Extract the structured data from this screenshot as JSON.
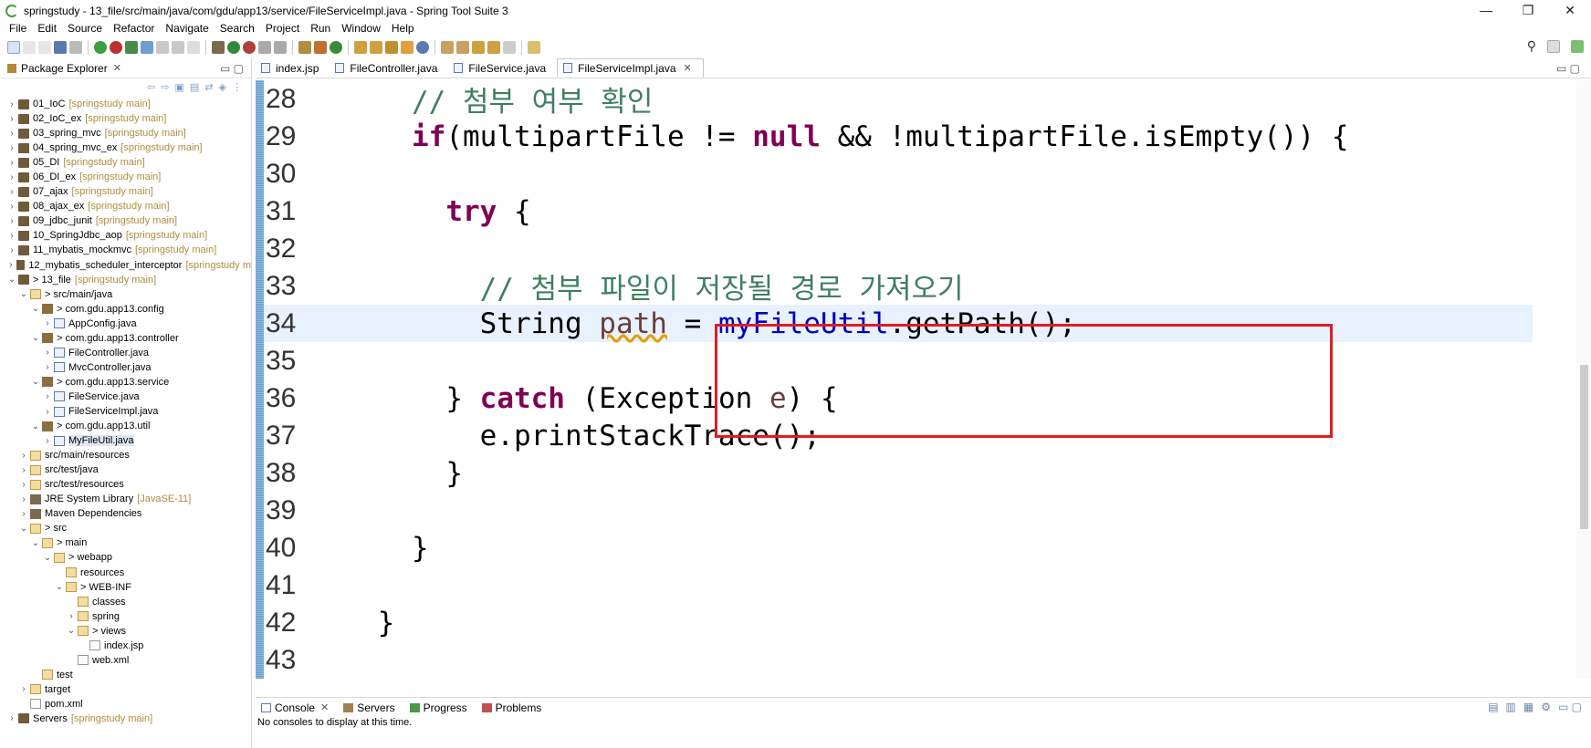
{
  "window": {
    "title": "springstudy - 13_file/src/main/java/com/gdu/app13/service/FileServiceImpl.java - Spring Tool Suite 3",
    "minimize": "—",
    "restore": "❐",
    "close": "✕"
  },
  "menu": [
    "File",
    "Edit",
    "Source",
    "Refactor",
    "Navigate",
    "Search",
    "Project",
    "Run",
    "Window",
    "Help"
  ],
  "package_explorer": {
    "title": "Package Explorer",
    "items": [
      {
        "indent": 0,
        "arrow": ">",
        "icon": "project",
        "label": "01_IoC",
        "dec": "[springstudy main]"
      },
      {
        "indent": 0,
        "arrow": ">",
        "icon": "project",
        "label": "02_IoC_ex",
        "dec": "[springstudy main]"
      },
      {
        "indent": 0,
        "arrow": ">",
        "icon": "project",
        "label": "03_spring_mvc",
        "dec": "[springstudy main]"
      },
      {
        "indent": 0,
        "arrow": ">",
        "icon": "project",
        "label": "04_spring_mvc_ex",
        "dec": "[springstudy main]"
      },
      {
        "indent": 0,
        "arrow": ">",
        "icon": "project",
        "label": "05_DI",
        "dec": "[springstudy main]"
      },
      {
        "indent": 0,
        "arrow": ">",
        "icon": "project",
        "label": "06_DI_ex",
        "dec": "[springstudy main]"
      },
      {
        "indent": 0,
        "arrow": ">",
        "icon": "project",
        "label": "07_ajax",
        "dec": "[springstudy main]"
      },
      {
        "indent": 0,
        "arrow": ">",
        "icon": "project",
        "label": "08_ajax_ex",
        "dec": "[springstudy main]"
      },
      {
        "indent": 0,
        "arrow": ">",
        "icon": "project",
        "label": "09_jdbc_junit",
        "dec": "[springstudy main]"
      },
      {
        "indent": 0,
        "arrow": ">",
        "icon": "project",
        "label": "10_SpringJdbc_aop",
        "dec": "[springstudy main]"
      },
      {
        "indent": 0,
        "arrow": ">",
        "icon": "project",
        "label": "11_mybatis_mockmvc",
        "dec": "[springstudy main]"
      },
      {
        "indent": 0,
        "arrow": ">",
        "icon": "project",
        "label": "12_mybatis_scheduler_interceptor",
        "dec": "[springstudy m"
      },
      {
        "indent": 0,
        "arrow": "v",
        "icon": "project",
        "label": "> 13_file",
        "dec": "[springstudy main]"
      },
      {
        "indent": 1,
        "arrow": "v",
        "icon": "folder",
        "label": "> src/main/java",
        "dec": ""
      },
      {
        "indent": 2,
        "arrow": "v",
        "icon": "pkg",
        "label": "> com.gdu.app13.config",
        "dec": ""
      },
      {
        "indent": 3,
        "arrow": ">",
        "icon": "java",
        "label": "AppConfig.java",
        "dec": ""
      },
      {
        "indent": 2,
        "arrow": "v",
        "icon": "pkg",
        "label": "> com.gdu.app13.controller",
        "dec": ""
      },
      {
        "indent": 3,
        "arrow": ">",
        "icon": "java",
        "label": "FileController.java",
        "dec": ""
      },
      {
        "indent": 3,
        "arrow": ">",
        "icon": "java",
        "label": "MvcController.java",
        "dec": ""
      },
      {
        "indent": 2,
        "arrow": "v",
        "icon": "pkg",
        "label": "> com.gdu.app13.service",
        "dec": ""
      },
      {
        "indent": 3,
        "arrow": ">",
        "icon": "java",
        "label": "FileService.java",
        "dec": ""
      },
      {
        "indent": 3,
        "arrow": ">",
        "icon": "java",
        "label": "FileServiceImpl.java",
        "dec": ""
      },
      {
        "indent": 2,
        "arrow": "v",
        "icon": "pkg",
        "label": "> com.gdu.app13.util",
        "dec": ""
      },
      {
        "indent": 3,
        "arrow": ">",
        "icon": "java",
        "label": "MyFileUtil.java",
        "dec": "",
        "selected": true
      },
      {
        "indent": 1,
        "arrow": ">",
        "icon": "folder",
        "label": "src/main/resources",
        "dec": ""
      },
      {
        "indent": 1,
        "arrow": ">",
        "icon": "folder",
        "label": "src/test/java",
        "dec": ""
      },
      {
        "indent": 1,
        "arrow": ">",
        "icon": "folder",
        "label": "src/test/resources",
        "dec": ""
      },
      {
        "indent": 1,
        "arrow": ">",
        "icon": "lib",
        "label": "JRE System Library",
        "dec": "[JavaSE-11]"
      },
      {
        "indent": 1,
        "arrow": ">",
        "icon": "lib",
        "label": "Maven Dependencies",
        "dec": ""
      },
      {
        "indent": 1,
        "arrow": "v",
        "icon": "folder",
        "label": "> src",
        "dec": ""
      },
      {
        "indent": 2,
        "arrow": "v",
        "icon": "folder",
        "label": "> main",
        "dec": ""
      },
      {
        "indent": 3,
        "arrow": "v",
        "icon": "folder",
        "label": "> webapp",
        "dec": ""
      },
      {
        "indent": 4,
        "arrow": "",
        "icon": "folder",
        "label": "resources",
        "dec": ""
      },
      {
        "indent": 4,
        "arrow": "v",
        "icon": "folder",
        "label": "> WEB-INF",
        "dec": ""
      },
      {
        "indent": 5,
        "arrow": "",
        "icon": "folder",
        "label": "classes",
        "dec": ""
      },
      {
        "indent": 5,
        "arrow": ">",
        "icon": "folder",
        "label": "spring",
        "dec": ""
      },
      {
        "indent": 5,
        "arrow": "v",
        "icon": "folder",
        "label": "> views",
        "dec": ""
      },
      {
        "indent": 6,
        "arrow": "",
        "icon": "file",
        "label": "index.jsp",
        "dec": ""
      },
      {
        "indent": 5,
        "arrow": "",
        "icon": "file",
        "label": "web.xml",
        "dec": ""
      },
      {
        "indent": 2,
        "arrow": "",
        "icon": "folder",
        "label": "test",
        "dec": ""
      },
      {
        "indent": 1,
        "arrow": ">",
        "icon": "folder",
        "label": "target",
        "dec": ""
      },
      {
        "indent": 1,
        "arrow": "",
        "icon": "file",
        "label": "pom.xml",
        "dec": ""
      },
      {
        "indent": 0,
        "arrow": ">",
        "icon": "project",
        "label": "Servers",
        "dec": "[springstudy main]"
      }
    ]
  },
  "editor_tabs": [
    {
      "label": "index.jsp",
      "active": false
    },
    {
      "label": "FileController.java",
      "active": false
    },
    {
      "label": "FileService.java",
      "active": false
    },
    {
      "label": "FileServiceImpl.java",
      "active": true
    }
  ],
  "code": {
    "l28": "28",
    "l29": "29",
    "l30": "30",
    "l31": "31",
    "l32": "32",
    "l33": "33",
    "l34": "34",
    "l35": "35",
    "l36": "36",
    "l37": "37",
    "l38": "38",
    "l39": "39",
    "l40": "40",
    "l41": "41",
    "l42": "42",
    "l43": "43",
    "comment1": "// 첨부 여부 확인",
    "if_kw": "if",
    "if_open": "(multipartFile != ",
    "null_kw": "null",
    "if_rest": " && !multipartFile.isEmpty()) {",
    "try_kw": "try",
    "try_rest": " {",
    "comment2": "// 첨부 파일이 저장될 경로 가져오기",
    "string_type": "String ",
    "path_var": "path",
    "assign": " = ",
    "util_field": "myFileUtil",
    "getpath": ".getPath();",
    "brace_close": "}",
    "catch_kw": "catch",
    "catch_open": " (Exception ",
    "e_var": "e",
    "catch_rest": ") {",
    "stacktrace": "e.printStackTrace();"
  },
  "console": {
    "tabs": [
      "Console",
      "Servers",
      "Progress",
      "Problems"
    ],
    "message": "No consoles to display at this time."
  }
}
